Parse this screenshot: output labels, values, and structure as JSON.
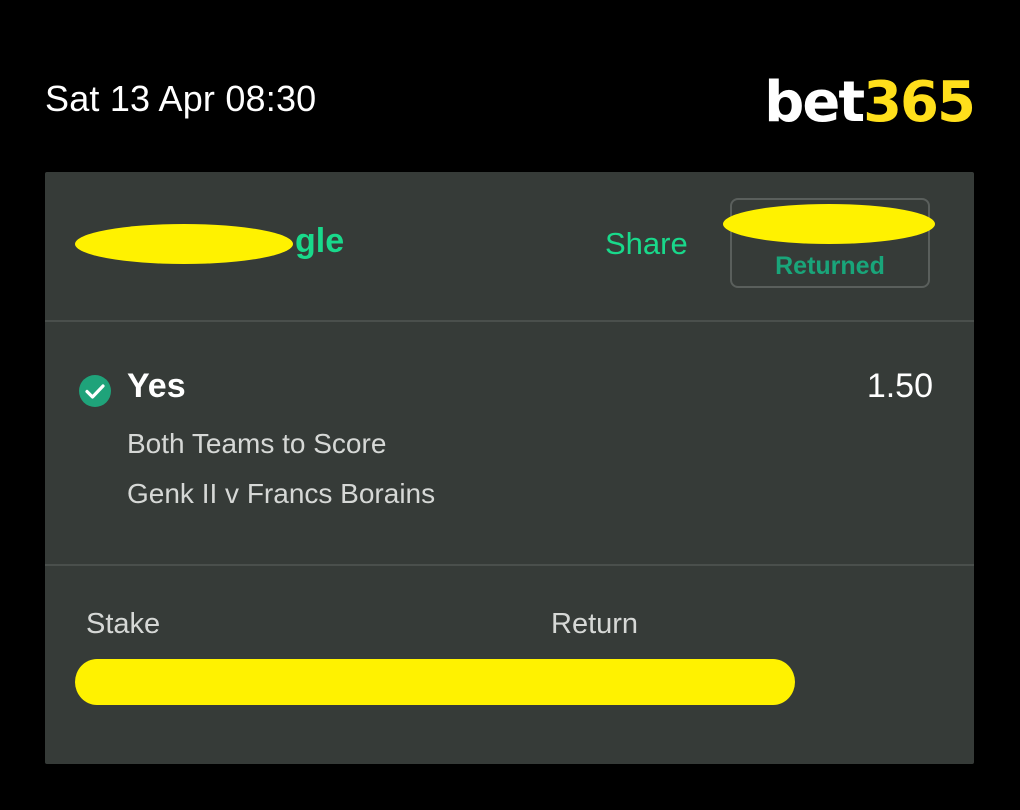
{
  "header": {
    "datetime": "Sat 13 Apr 08:30",
    "logo_white": "bet",
    "logo_yellow": "365"
  },
  "bet": {
    "type_suffix": "gle",
    "share_label": "Share",
    "status": "Returned"
  },
  "selection": {
    "name": "Yes",
    "odds": "1.50",
    "market": "Both Teams to Score",
    "fixture": "Genk II v Francs Borains",
    "result_icon": "check-circle-icon"
  },
  "summary": {
    "stake_label": "Stake",
    "return_label": "Return"
  },
  "colors": {
    "accent_green": "#19d98b",
    "brand_yellow": "#ffdf1b",
    "card_bg": "#363b38",
    "redaction": "#fff200"
  }
}
